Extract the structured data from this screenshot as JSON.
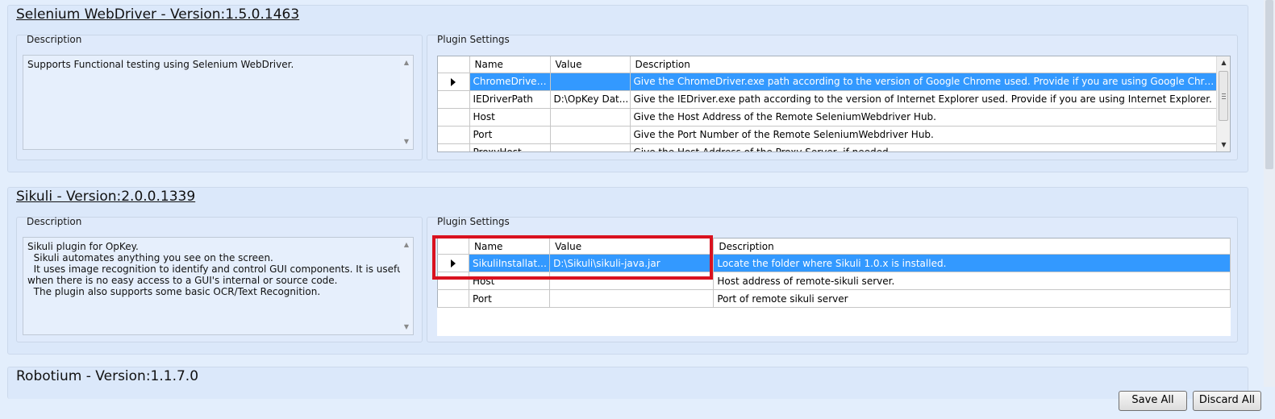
{
  "plugins": [
    {
      "title": "Selenium WebDriver - Version:1.5.0.1463",
      "description_label": "Description",
      "description_lines": [
        "Supports Functional testing using Selenium WebDriver."
      ],
      "settings_label": "Plugin Settings",
      "columns": [
        "Name",
        "Value",
        "Description"
      ],
      "rows": [
        {
          "name": "ChromeDriverP...",
          "value": "",
          "description": "Give the ChromeDriver.exe path according to the version of Google Chrome used. Provide if you are using Google Chrome."
        },
        {
          "name": "IEDriverPath",
          "value": "D:\\OpKey Dat...",
          "description": "Give the IEDriver.exe path according to the version of Internet Explorer used. Provide if you are using Internet Explorer."
        },
        {
          "name": "Host",
          "value": "",
          "description": "Give the Host Address of the Remote SeleniumWebdriver Hub."
        },
        {
          "name": "Port",
          "value": "",
          "description": "Give the Port Number of the Remote SeleniumWebdriver Hub."
        },
        {
          "name": "ProxyHost",
          "value": "",
          "description": "Give the Host Address of the Proxy Server, if needed."
        }
      ]
    },
    {
      "title": "Sikuli - Version:2.0.0.1339",
      "description_label": "Description",
      "description_lines": [
        "Sikuli plugin for OpKey.",
        "  Sikuli automates anything you see on the screen.",
        "  It uses image recognition to identify and control GUI components. It is useful",
        "when there is no easy access to a GUI's internal or source code.",
        "  The plugin also supports some basic OCR/Text Recognition."
      ],
      "settings_label": "Plugin Settings",
      "columns": [
        "Name",
        "Value",
        "Description"
      ],
      "rows": [
        {
          "name": "SikuliInstallatio...",
          "value": "D:\\Sikuli\\sikuli-java.jar",
          "description": "Locate the folder where Sikuli 1.0.x is installed."
        },
        {
          "name": "Host",
          "value": "",
          "description": "Host address of remote-sikuli server."
        },
        {
          "name": "Port",
          "value": "",
          "description": "Port of remote sikuli server"
        }
      ]
    },
    {
      "title": "Robotium - Version:1.1.7.0"
    }
  ],
  "buttons": {
    "save_all": "Save All",
    "discard_all": "Discard All"
  },
  "colors": {
    "selection": "#3399ff",
    "highlight": "#d9121f"
  }
}
